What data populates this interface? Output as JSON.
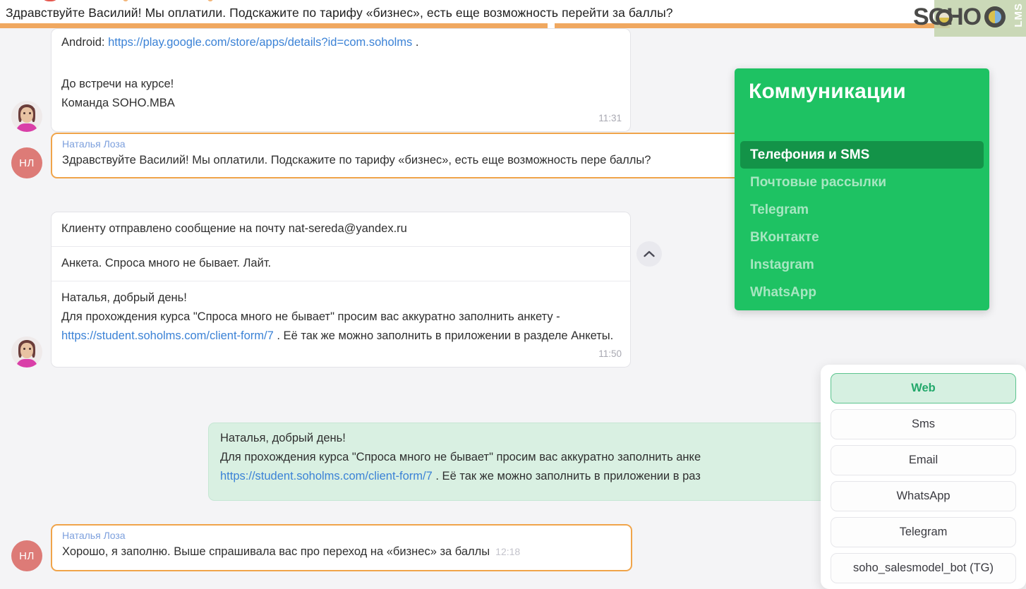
{
  "banner": {
    "text": "Здравствуйте Василий! Мы оплатили. Подскажите по тарифу «бизнес», есть еще возможность перейти за баллы?",
    "rule_color": "#f0a860"
  },
  "logo": {
    "text": "SOHO",
    "suffix": "LMS",
    "accent_color": "#4a4a48",
    "badge_color": "#c2d2ab"
  },
  "chat": {
    "messages": [
      {
        "id": "msg1",
        "avatar_type": "photo",
        "android_label": "Android:",
        "android_link": "https://play.google.com/store/apps/details?id=com.soholms",
        "android_tail": ".",
        "line_a": "До встречи на курсе!",
        "line_b": "Команда SOHO.MBA",
        "time": "11:31"
      },
      {
        "id": "msg2",
        "avatar_initials": "НЛ",
        "sender": "Наталья Лоза",
        "text": "Здравствуйте Василий! Мы оплатили. Подскажите по тарифу «бизнес», есть еще возможность пере баллы?"
      },
      {
        "id": "msg3",
        "avatar_type": "photo",
        "header": "Клиенту отправлено сообщение на почту nat-sereda@yandex.ru",
        "subject": "Анкета. Спроса много не бывает. Лайт.",
        "body_line1": "Наталья, добрый день!",
        "body_line2": "Для прохождения курса \"Спроса много не бывает\" просим вас аккуратно заполнить анкету -",
        "body_link": "https://student.soholms.com/client-form/7",
        "body_line3": ". Её так же можно заполнить в приложении в разделе Анкеты.",
        "time": "11:50",
        "collapse_icon": "chevron-up"
      },
      {
        "id": "msg4",
        "line1": "Наталья, добрый день!",
        "line2": "Для прохождения курса \"Спроса много не бывает\" просим вас аккуратно заполнить анке",
        "link": "https://student.soholms.com/client-form/7",
        "line3": ". Её так же можно заполнить в приложении в раз"
      },
      {
        "id": "msg5",
        "avatar_initials": "НЛ",
        "sender": "Наталья Лоза",
        "text": "Хорошо, я заполню. Выше спрашивала вас про переход на «бизнес» за баллы",
        "time": "12:18"
      }
    ]
  },
  "communications": {
    "title": "Коммуникации",
    "accent_color": "#1ec263",
    "active_color": "#139348",
    "items": [
      {
        "label": "Телефония и SMS",
        "active": true
      },
      {
        "label": "Почтовые рассылки",
        "active": false
      },
      {
        "label": "Telegram",
        "active": false
      },
      {
        "label": "ВКонтакте",
        "active": false
      },
      {
        "label": "Instagram",
        "active": false
      },
      {
        "label": "WhatsApp",
        "active": false
      }
    ]
  },
  "channels": {
    "selected_color": "#23a86b",
    "items": [
      {
        "label": "Web",
        "selected": true
      },
      {
        "label": "Sms",
        "selected": false
      },
      {
        "label": "Email",
        "selected": false
      },
      {
        "label": "WhatsApp",
        "selected": false
      },
      {
        "label": "Telegram",
        "selected": false
      },
      {
        "label": "soho_salesmodel_bot (TG)",
        "selected": false
      }
    ]
  }
}
